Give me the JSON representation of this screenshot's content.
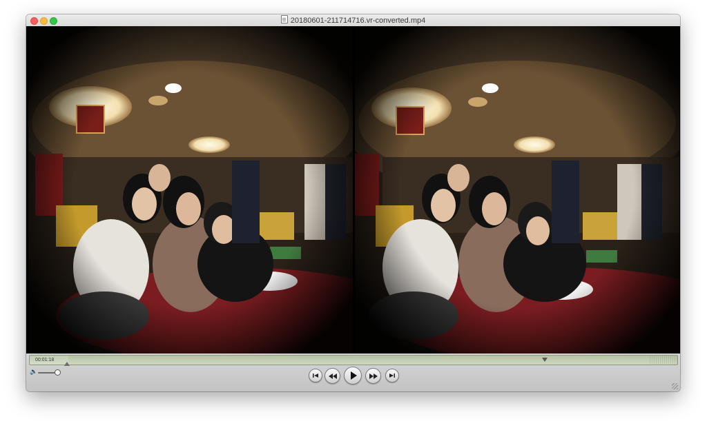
{
  "window": {
    "title": "20180601-211714716.vr-converted.mp4"
  },
  "player": {
    "current_time": "00:01:18",
    "progress": 0.06
  },
  "controls": {
    "buttons": [
      "go-to-start",
      "rewind",
      "play",
      "fast-forward",
      "go-to-end"
    ]
  },
  "colors": {
    "close": "#fc605b",
    "minimize": "#fdbc40",
    "maximize": "#34c84a",
    "timeline": "#c3ccb3"
  }
}
